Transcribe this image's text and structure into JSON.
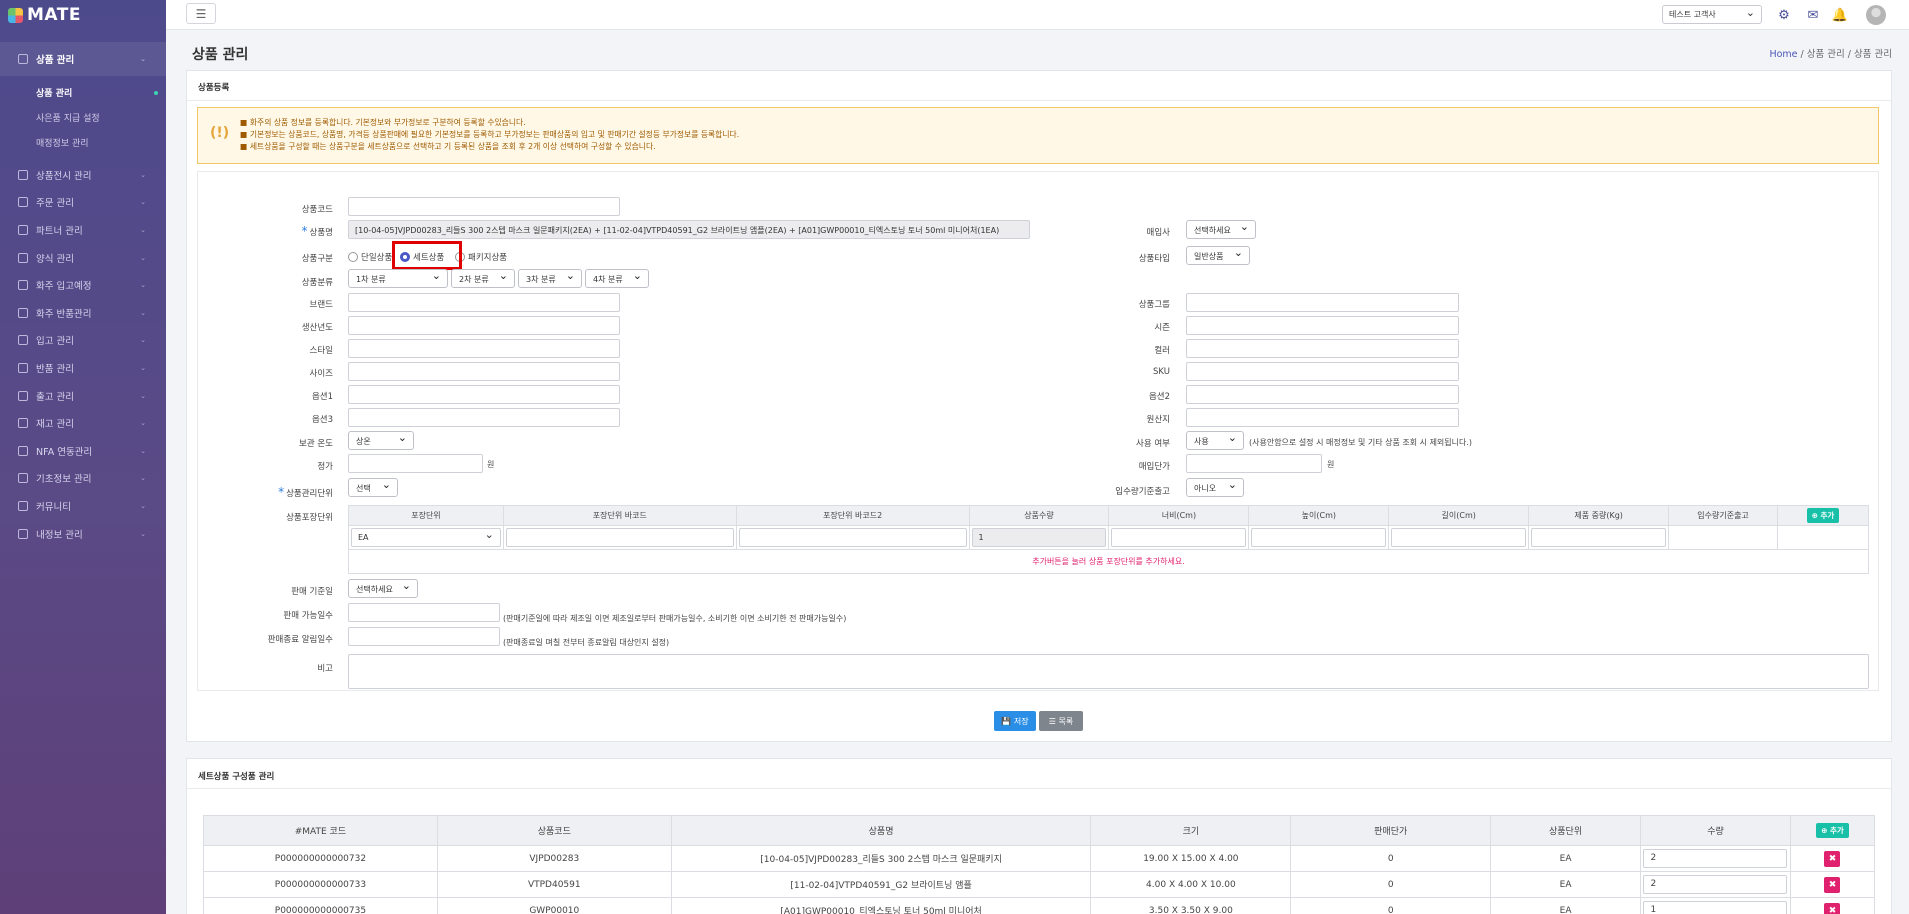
{
  "app": {
    "logo": "MATE"
  },
  "sidebar": {
    "active_group": "상품 관리",
    "sub_items": [
      "상품 관리",
      "사은품 지급 설정",
      "매정정보 관리"
    ],
    "items": [
      "상품전시 관리",
      "주문 관리",
      "파트너 관리",
      "양식 관리",
      "화주 입고예정",
      "화주 반품관리",
      "입고 관리",
      "반품 관리",
      "출고 관리",
      "재고 관리",
      "NFA 연동관리",
      "기초정보 관리",
      "커뮤니티",
      "내정보 관리"
    ]
  },
  "topbar": {
    "shop_select": "테스트 고객사"
  },
  "page": {
    "title": "상품 관리",
    "breadcrumb": [
      "Home",
      "상품 관리",
      "상품 관리"
    ]
  },
  "card": {
    "title": "상품등록",
    "notice": [
      "■ 화주의 상품 정보를 등록합니다. 기본정보와 부가정보로 구분하여 등록할 수있습니다.",
      "■ 기본정보는 상품코드, 상품명, 가격등 상품판매에 필요한 기본정보를 등록하고 부가정보는 판매상품의 입고 및 판매기간 설정등 부가정보를 등록합니다.",
      "■ 세트상품을 구성할 때는 상품구분을 세트상품으로 선택하고 기 등록된 상품을 조회 후 2개 이상 선택하여 구성할 수 있습니다."
    ]
  },
  "form": {
    "product_code": {
      "label": "상품코드",
      "value": ""
    },
    "product_name": {
      "label": "상품명",
      "value": "[10-04-05]VJPD00283_리들S 300 2스텝 마스크 일문패키지(2EA) + [11-02-04]VTPD40591_G2 브라이트닝 앰플(2EA) + [A01]GWP00010_티엑스토닝 토너 50ml 미니어처(1EA)"
    },
    "purchaser": {
      "label": "매입사",
      "value": "선택하세요"
    },
    "product_type_group": {
      "label": "상품구분",
      "options": [
        "단일상품",
        "세트상품",
        "패키지상품"
      ],
      "selected": "세트상품"
    },
    "product_kind": {
      "label": "상품타입",
      "value": "일반상품"
    },
    "category": {
      "label": "상품분류",
      "values": [
        "1차 분류",
        "2차 분류",
        "3차 분류",
        "4차 분류"
      ]
    },
    "brand": {
      "label": "브랜드"
    },
    "product_group": {
      "label": "상품그룹"
    },
    "production_year": {
      "label": "생산년도"
    },
    "season": {
      "label": "시즌"
    },
    "style": {
      "label": "스타일"
    },
    "color": {
      "label": "컬러"
    },
    "size": {
      "label": "사이즈"
    },
    "sku": {
      "label": "SKU"
    },
    "option1": {
      "label": "옵션1"
    },
    "option2": {
      "label": "옵션2"
    },
    "option3": {
      "label": "옵션3"
    },
    "origin": {
      "label": "원산지"
    },
    "storage_temp": {
      "label": "보관 온도",
      "value": "상온"
    },
    "use_flag": {
      "label": "사용 여부",
      "value": "사용",
      "hint": "(사용안함으로 설정 시 매정정보 및 기타 상품 조회 시 제외됩니다.)"
    },
    "price": {
      "label": "정가",
      "unit": "원"
    },
    "purchase_price": {
      "label": "매입단가",
      "unit": "원"
    },
    "mgmt_unit": {
      "label": "상품관리단위",
      "value": "선택"
    },
    "inbound_basis": {
      "label": "입수량기준출고",
      "value": "아니오"
    },
    "pack_unit": {
      "label": "상품포장단위",
      "headers": [
        "포장단위",
        "포장단위 바코드",
        "포장단위 바코드2",
        "상품수량",
        "너비(Cm)",
        "높이(Cm)",
        "길이(Cm)",
        "제품 중량(Kg)",
        "입수량기준출고"
      ],
      "add_label": "⊕ 추가",
      "row": {
        "unit": "EA",
        "qty": "1"
      },
      "hint": "추가버튼을 눌러 상품 포장단위를 추가하세요."
    },
    "sale_basis": {
      "label": "판매 기준일",
      "value": "선택하세요"
    },
    "sale_days": {
      "label": "판매 가능일수",
      "hint": "(판매기준일에 따라 제조일 이면 제조일로부터 판매가능일수, 소비기한 이면 소비기한 전 판매가능일수)"
    },
    "end_alert_days": {
      "label": "판매종료 알림일수",
      "hint": "(판매종료일 며칠 전부터 종료알림 대상인지 설정)"
    },
    "memo": {
      "label": "비고"
    }
  },
  "buttons": {
    "save": "💾 저장",
    "list": "☰ 목록"
  },
  "set_card": {
    "title": "세트상품 구성품 관리",
    "headers": [
      "#MATE 코드",
      "상품코드",
      "상품명",
      "크기",
      "판매단가",
      "상품단위",
      "수량"
    ],
    "add_label": "⊕ 추가",
    "rows": [
      {
        "mate": "P000000000000732",
        "code": "VJPD00283",
        "name": "[10-04-05]VJPD00283_리들S 300 2스텝 마스크 일문패키지",
        "size": "19.00 X 15.00 X 4.00",
        "price": "0",
        "unit": "EA",
        "qty": "2"
      },
      {
        "mate": "P000000000000733",
        "code": "VTPD40591",
        "name": "[11-02-04]VTPD40591_G2 브라이트닝 앰플",
        "size": "4.00 X 4.00 X 10.00",
        "price": "0",
        "unit": "EA",
        "qty": "2"
      },
      {
        "mate": "P000000000000735",
        "code": "GWP00010",
        "name": "[A01]GWP00010_티엑스토닝 토너 50ml 미니어처",
        "size": "3.50 X 3.50 X 9.00",
        "price": "0",
        "unit": "EA",
        "qty": "1"
      }
    ]
  }
}
